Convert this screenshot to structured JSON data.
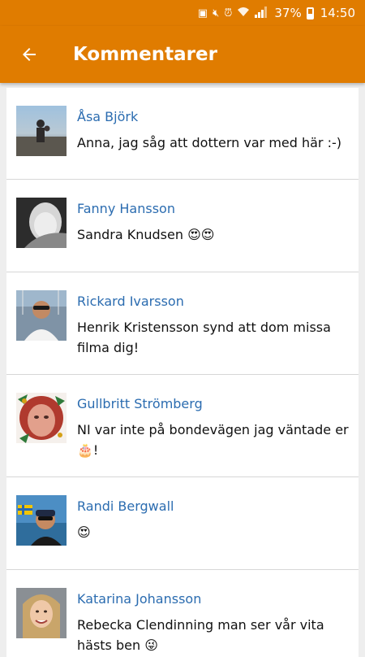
{
  "status_bar": {
    "battery_percent": "37%",
    "time": "14:50",
    "icons": [
      "sim-icon",
      "mute-icon",
      "alarm-icon",
      "wifi-icon",
      "signal-icon",
      "battery-icon"
    ]
  },
  "app_bar": {
    "title": "Kommentarer",
    "back_icon": "arrow-left-icon"
  },
  "colors": {
    "primary": "#e07c00",
    "name_link": "#2b6cb0"
  },
  "comments": [
    {
      "name": "Åsa Björk",
      "text": "Anna, jag såg att dottern var med här :-)"
    },
    {
      "name": "Fanny Hansson",
      "text": "Sandra Knudsen 😍😍"
    },
    {
      "name": "Rickard Ivarsson",
      "text": "Henrik Kristensson synd att dom missa filma dig!"
    },
    {
      "name": "Gullbritt Strömberg",
      "text": "NI var inte på bondevägen jag väntade er 🎂!"
    },
    {
      "name": "Randi Bergwall",
      "text": "😍"
    },
    {
      "name": "Katarina Johansson",
      "text": "Rebecka Clendinning man ser vår vita hästs ben 😜"
    }
  ]
}
